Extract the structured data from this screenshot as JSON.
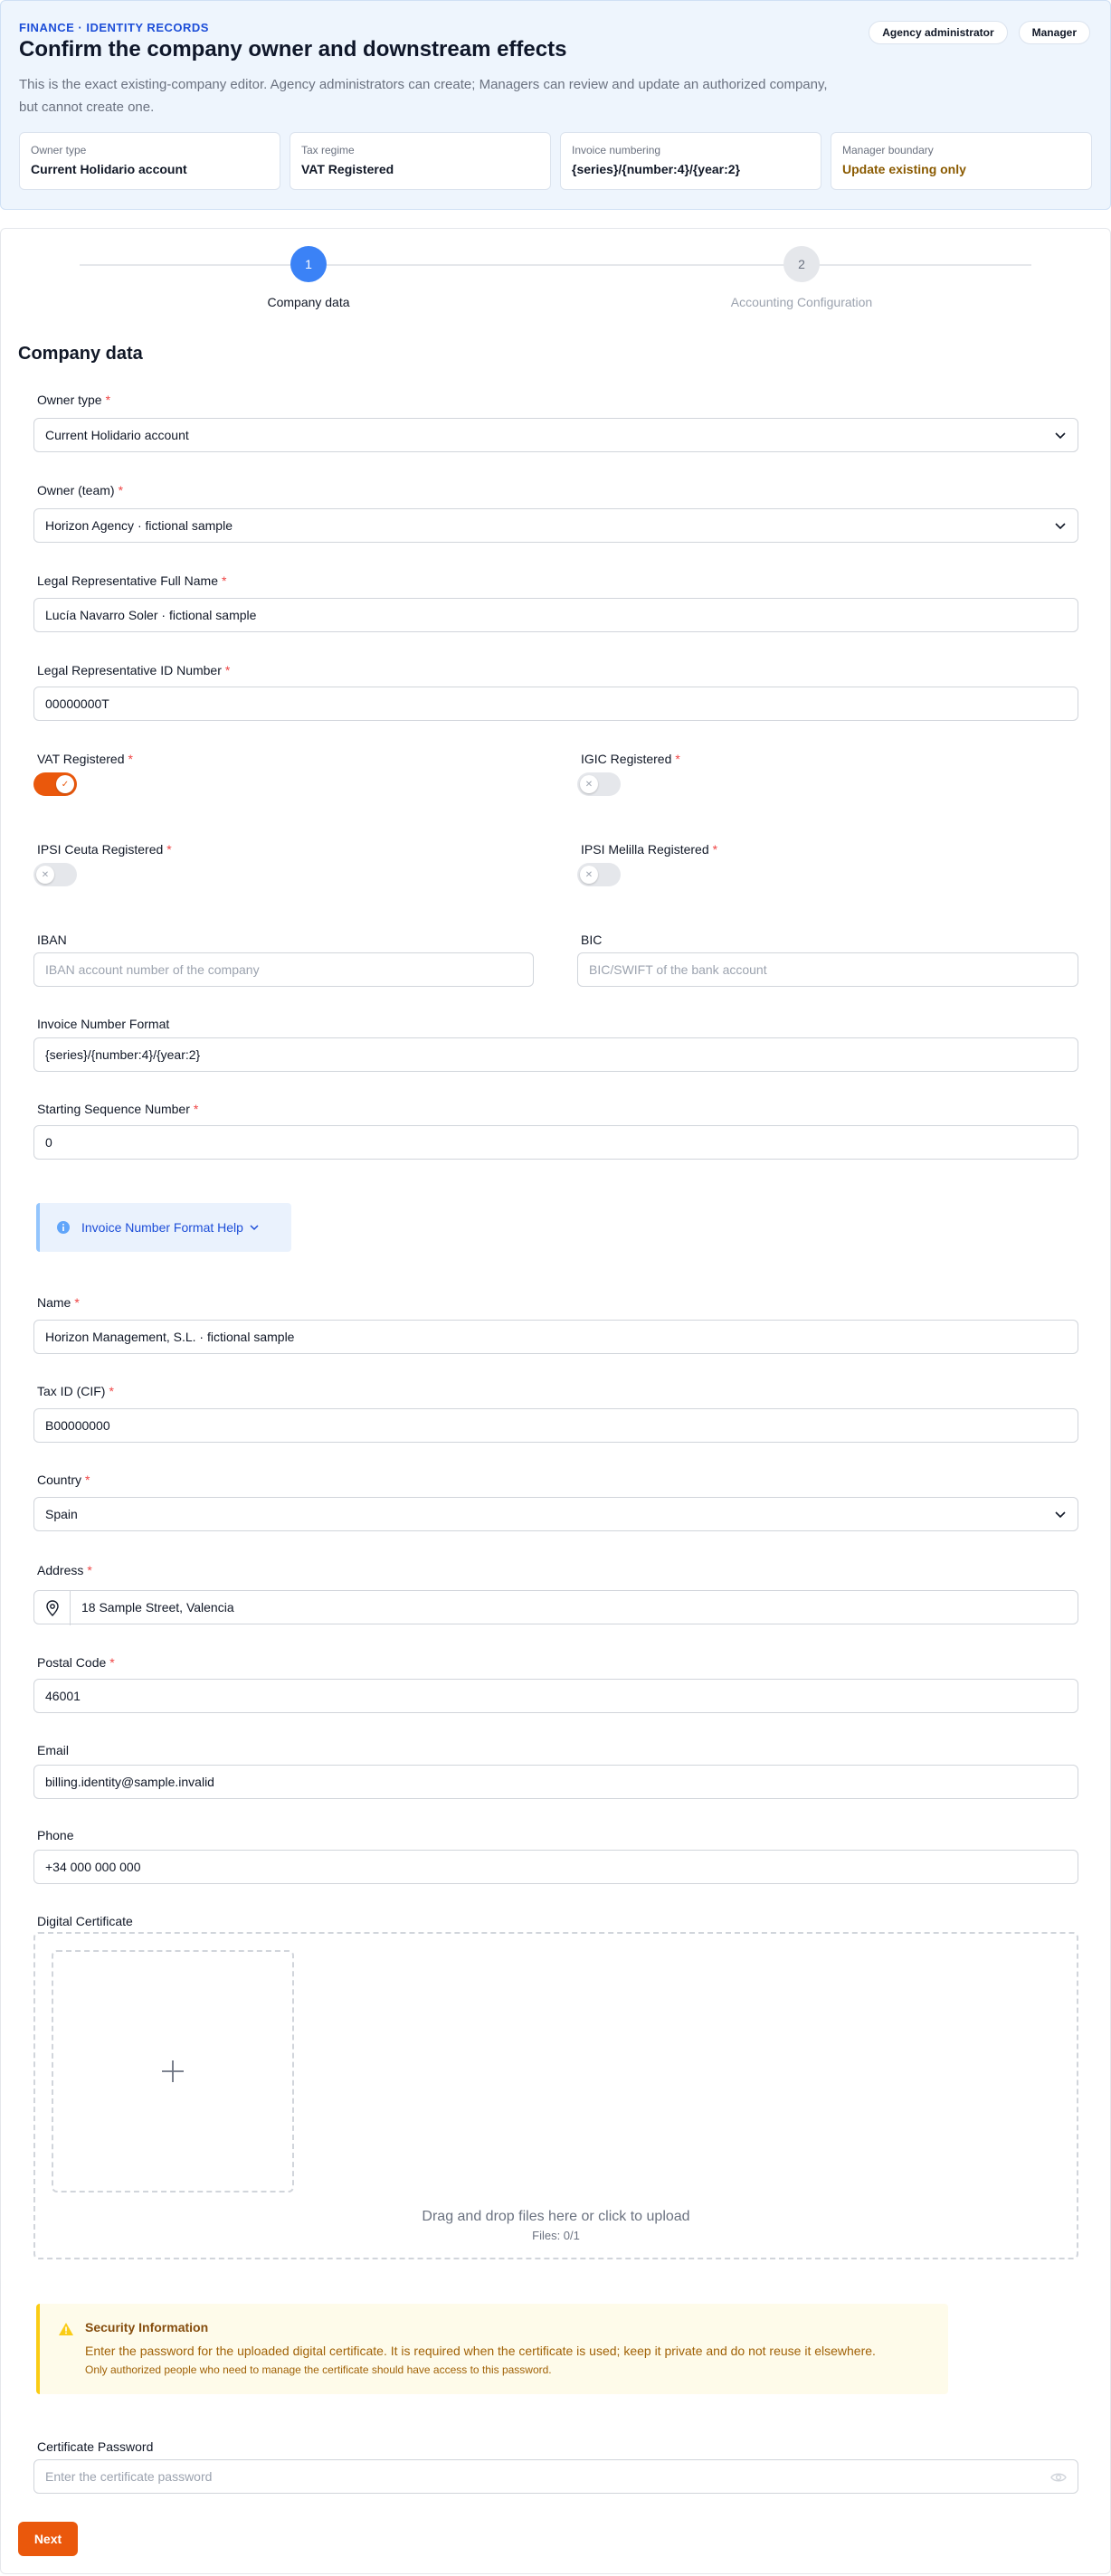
{
  "header": {
    "eyebrow": "FINANCE · IDENTITY RECORDS",
    "title": "Confirm the company owner and downstream effects",
    "description": "This is the exact existing-company editor. Agency administrators can create; Managers can review and update an authorized company, but cannot create one.",
    "roles": [
      "Agency administrator",
      "Manager"
    ],
    "summary": [
      {
        "label": "Owner type",
        "value": "Current Holidario account"
      },
      {
        "label": "Tax regime",
        "value": "VAT Registered"
      },
      {
        "label": "Invoice numbering",
        "value": "{series}/{number:4}/{year:2}"
      },
      {
        "label": "Manager boundary",
        "value": "Update existing only"
      }
    ]
  },
  "steps": [
    {
      "number": "1",
      "label": "Company data",
      "active": true
    },
    {
      "number": "2",
      "label": "Accounting Configuration",
      "active": false
    }
  ],
  "form": {
    "section_title": "Company data",
    "owner_type": {
      "label": "Owner type",
      "value": "Current Holidario account"
    },
    "owner_team": {
      "label": "Owner (team)",
      "value": "Horizon Agency · fictional sample"
    },
    "legal_rep_name": {
      "label": "Legal Representative Full Name",
      "value": "Lucía Navarro Soler · fictional sample"
    },
    "legal_rep_id": {
      "label": "Legal Representative ID Number",
      "value": "00000000T"
    },
    "vat": {
      "label": "VAT Registered",
      "on": true
    },
    "igic": {
      "label": "IGIC Registered",
      "on": false
    },
    "ipsi_ceuta": {
      "label": "IPSI Ceuta Registered",
      "on": false
    },
    "ipsi_melilla": {
      "label": "IPSI Melilla Registered",
      "on": false
    },
    "iban": {
      "label": "IBAN",
      "placeholder": "IBAN account number of the company"
    },
    "bic": {
      "label": "BIC",
      "placeholder": "BIC/SWIFT of the bank account"
    },
    "invoice_format": {
      "label": "Invoice Number Format",
      "value": "{series}/{number:4}/{year:2}"
    },
    "starting_sequence": {
      "label": "Starting Sequence Number",
      "value": "0"
    },
    "help_label": "Invoice Number Format Help",
    "name": {
      "label": "Name",
      "value": "Horizon Management, S.L. · fictional sample"
    },
    "tax_id": {
      "label": "Tax ID (CIF)",
      "value": "B00000000"
    },
    "country": {
      "label": "Country",
      "value": "Spain"
    },
    "address": {
      "label": "Address",
      "value": "18 Sample Street, Valencia"
    },
    "postal_code": {
      "label": "Postal Code",
      "value": "46001"
    },
    "email": {
      "label": "Email",
      "value": "billing.identity@sample.invalid"
    },
    "phone": {
      "label": "Phone",
      "value": "+34 000 000 000"
    },
    "certificate": {
      "label": "Digital Certificate",
      "drop_text": "Drag and drop files here or click to upload",
      "files_count": "Files: 0/1"
    },
    "security": {
      "title": "Security Information",
      "text": "Enter the password for the uploaded digital certificate. It is required when the certificate is used; keep it private and do not reuse it elsewhere.",
      "subtext": "Only authorized people who need to manage the certificate should have access to this password."
    },
    "cert_password": {
      "label": "Certificate Password",
      "placeholder": "Enter the certificate password"
    },
    "next_label": "Next"
  },
  "colors": {
    "accent": "#ea580c",
    "primary": "#3b82f6",
    "required": "#ef4444"
  }
}
